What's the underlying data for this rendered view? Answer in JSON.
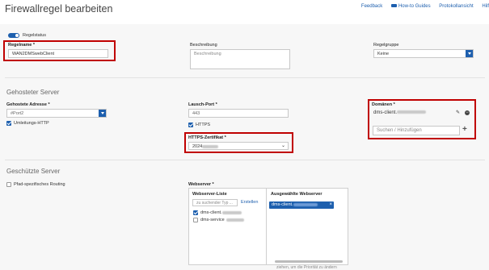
{
  "page": {
    "title": "Firewallregel bearbeiten",
    "links": {
      "feedback": "Feedback",
      "howto": "How-to Guides",
      "protokoll": "Protokollansicht",
      "hilfe": "Hilf"
    }
  },
  "rule": {
    "status_label": "Regelstatus",
    "status_on": true,
    "name_label": "Regelname *",
    "name_value": "WAN2DMSwebClient",
    "desc_label": "Beschreibung",
    "desc_placeholder": "Beschreibung",
    "group_label": "Regelgruppe",
    "group_value": "Keine"
  },
  "hosted": {
    "section_title": "Gehosteter Server",
    "addr_label": "Gehostete Adresse *",
    "addr_value": "#Port2",
    "redirect_label": "Umleitungs-HTTP",
    "redirect_checked": true,
    "port_label": "Lausch-Port *",
    "port_value": "443",
    "https_label": "HTTPS",
    "https_checked": true,
    "cert_label": "HTTPS-Zertifikat *",
    "cert_value": "2024",
    "domains_label": "Domänen *",
    "domain_value": "dms-client.",
    "search_placeholder": "Suchen / Hinzufügen"
  },
  "protected": {
    "section_title": "Geschützte Server",
    "pathrouting_label": "Pfad-spezifisches Routing",
    "pathrouting_checked": false,
    "webserver_label": "Webserver *",
    "list_title": "Webserver-Liste",
    "list_search_placeholder": "zu suchender Typ ...",
    "create_link": "Erstellen",
    "items": [
      {
        "label": "dms-client.",
        "checked": true
      },
      {
        "label": "dms-service",
        "checked": false
      }
    ],
    "selected_title": "Ausgewählte Webserver",
    "selected_item": "dms-client.",
    "drag_hint": "ziehen, um die Priorität zu ändern"
  },
  "colors": {
    "accent": "#1d5fae",
    "highlight": "#c00000"
  }
}
